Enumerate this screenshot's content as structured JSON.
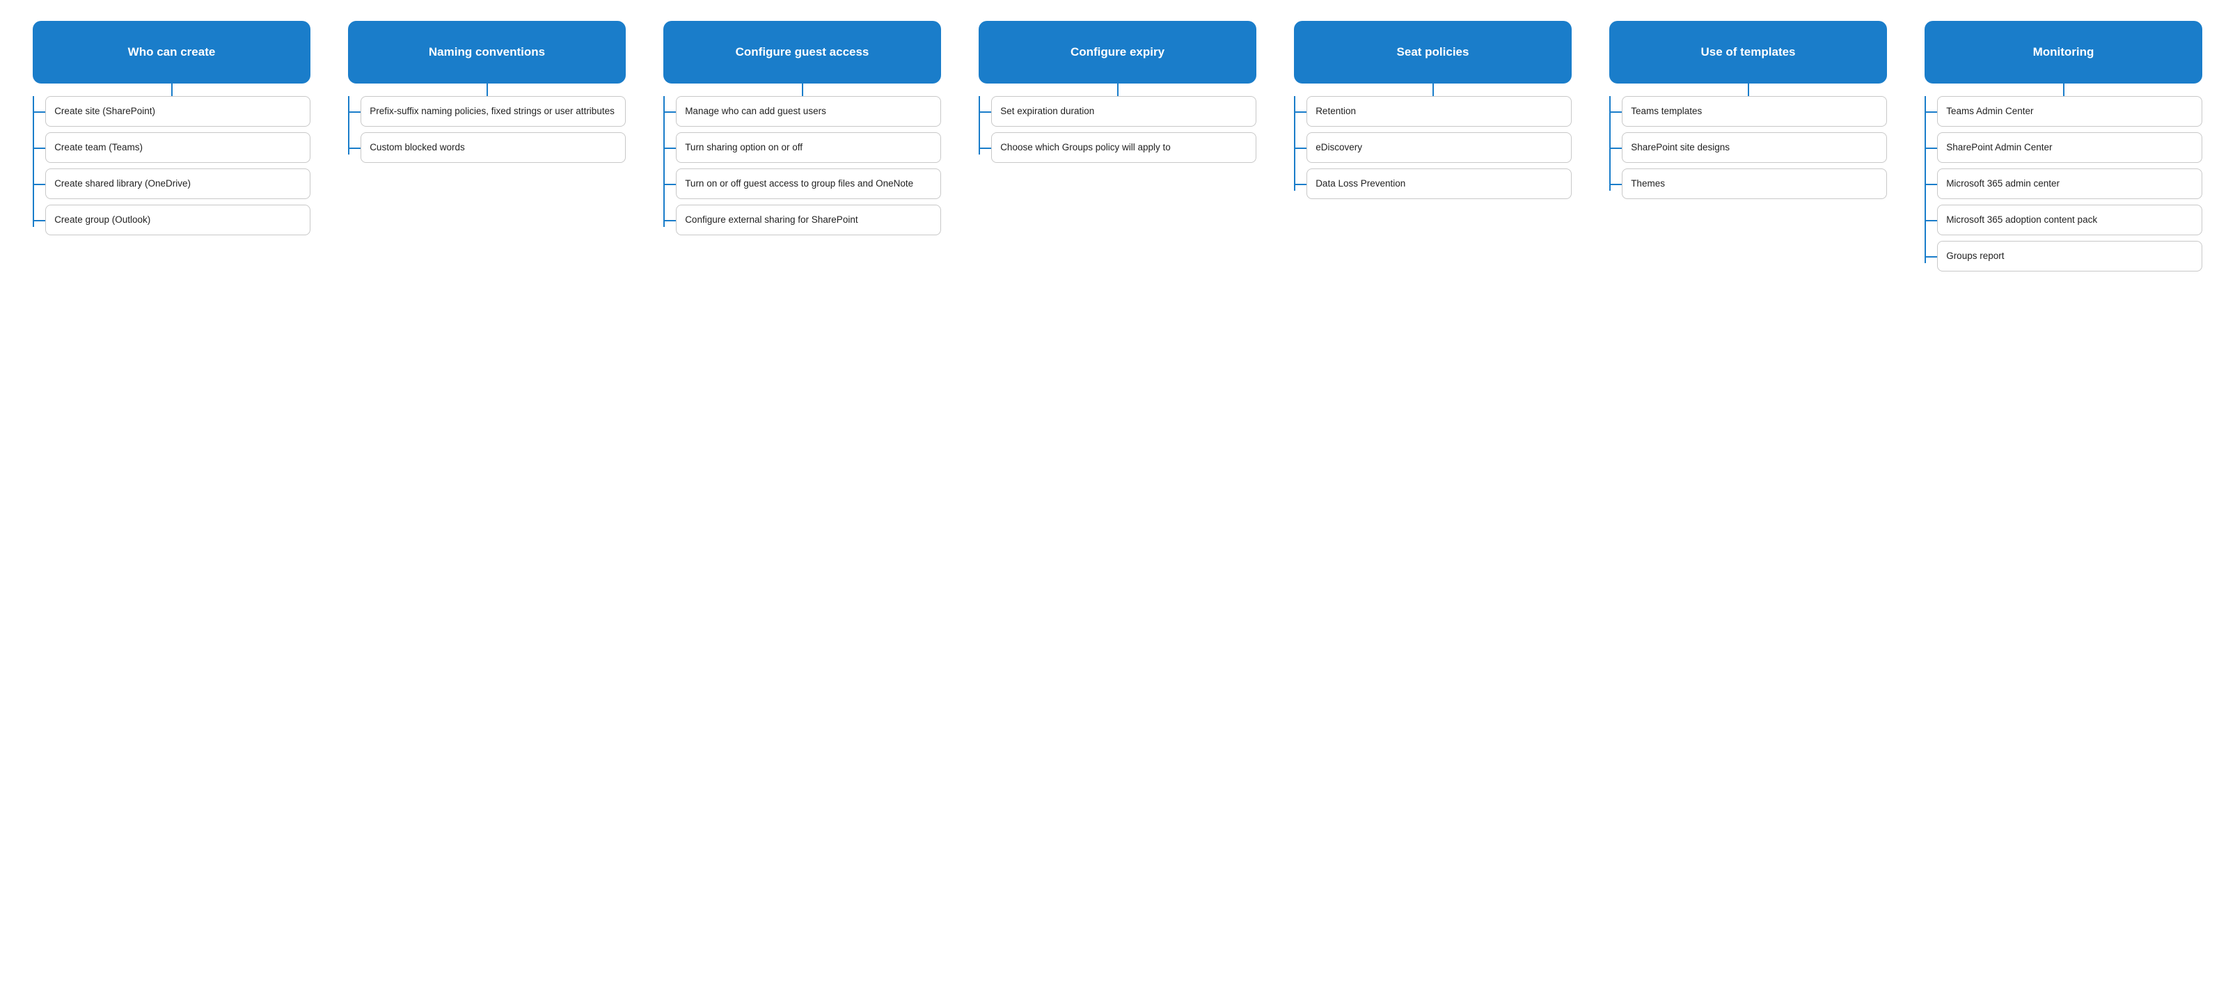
{
  "columns": [
    {
      "id": "who-can-create",
      "header": "Who can create",
      "children": [
        "Create site (SharePoint)",
        "Create team (Teams)",
        "Create shared library (OneDrive)",
        "Create group (Outlook)"
      ]
    },
    {
      "id": "naming-conventions",
      "header": "Naming conventions",
      "children": [
        "Prefix-suffix naming policies, fixed strings or user attributes",
        "Custom blocked words"
      ]
    },
    {
      "id": "configure-guest-access",
      "header": "Configure guest access",
      "children": [
        "Manage who can add guest users",
        "Turn sharing option on or off",
        "Turn on or off guest access to group files and OneNote",
        "Configure external sharing for SharePoint"
      ]
    },
    {
      "id": "configure-expiry",
      "header": "Configure expiry",
      "children": [
        "Set expiration duration",
        "Choose which Groups policy will apply to"
      ]
    },
    {
      "id": "seat-policies",
      "header": "Seat policies",
      "children": [
        "Retention",
        "eDiscovery",
        "Data Loss Prevention"
      ]
    },
    {
      "id": "use-of-templates",
      "header": "Use of templates",
      "children": [
        "Teams templates",
        "SharePoint site designs",
        "Themes"
      ]
    },
    {
      "id": "monitoring",
      "header": "Monitoring",
      "children": [
        "Teams Admin Center",
        "SharePoint Admin Center",
        "Microsoft 365 admin center",
        "Microsoft 365 adoption content pack",
        "Groups report"
      ]
    }
  ]
}
